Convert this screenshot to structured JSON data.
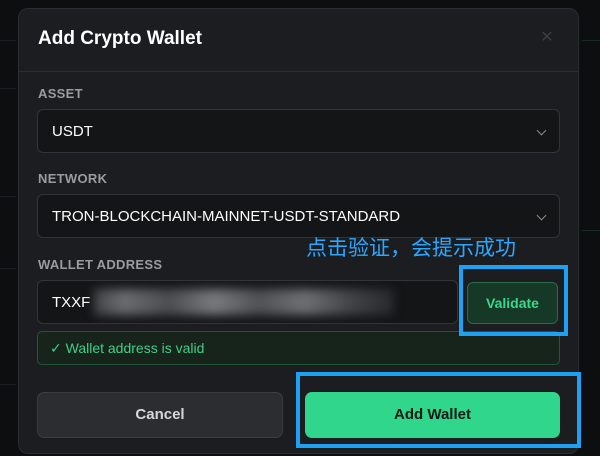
{
  "modal": {
    "title": "Add Crypto Wallet",
    "close_symbol": "✕"
  },
  "asset": {
    "label": "ASSET",
    "value": "USDT"
  },
  "network": {
    "label": "NETWORK",
    "value": "TRON-BLOCKCHAIN-MAINNET-USDT-STANDARD"
  },
  "wallet_address": {
    "label": "WALLET ADDRESS",
    "visible_prefix": "TXXF"
  },
  "validate_label": "Validate",
  "status": {
    "message": "✓ Wallet address is valid",
    "color": "#3fcf86"
  },
  "actions": {
    "cancel_label": "Cancel",
    "submit_label": "Add Wallet"
  },
  "annotation": {
    "text": "点击验证，会提示成功",
    "color": "#2aa8ff"
  },
  "colors": {
    "accent": "#2fd68b",
    "highlight": "#1da1f5"
  }
}
